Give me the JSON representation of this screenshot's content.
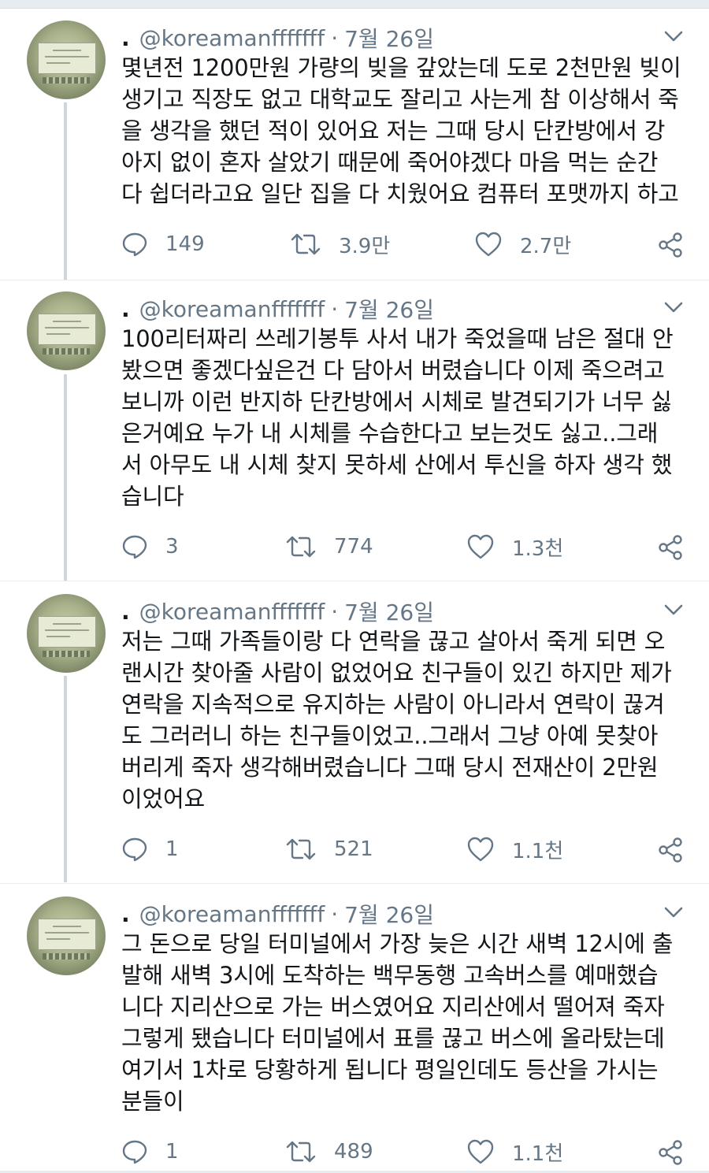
{
  "tweets": [
    {
      "handle": "@koreamanfffffff",
      "date": "7월 26일",
      "text": "몇년전 1200만원 가량의 빚을 갚았는데 도로 2천만원 빚이\n생기고 직장도 없고 대학교도 잘리고 사는게 참 이상해서 죽\n을 생각을 했던 적이 있어요 저는 그때 당시 단칸방에서 강\n아지 없이 혼자 살았기 때문에 죽어야겠다 마음 먹는 순간\n다 쉽더라고요 일단 집을 다 치웠어요 컴퓨터 포맷까지 하고",
      "replies": "149",
      "retweets": "3.9만",
      "likes": "2.7만"
    },
    {
      "handle": "@koreamanfffffff",
      "date": "7월 26일",
      "text": "100리터짜리 쓰레기봉투 사서 내가 죽었을때 남은 절대 안\n봤으면 좋겠다싶은건 다 담아서 버렸습니다 이제 죽으려고\n보니까 이런 반지하 단칸방에서 시체로 발견되기가 너무 싫\n은거예요 누가 내 시체를 수습한다고 보는것도 싫고..그래\n서 아무도 내 시체 찾지 못하세 산에서 투신을 하자 생각 했\n습니다",
      "replies": "3",
      "retweets": "774",
      "likes": "1.3천"
    },
    {
      "handle": "@koreamanfffffff",
      "date": "7월 26일",
      "text": "저는 그때 가족들이랑 다 연락을 끊고 살아서 죽게 되면 오\n랜시간 찾아줄 사람이 없었어요 친구들이 있긴 하지만 제가\n연락을 지속적으로 유지하는 사람이 아니라서 연락이 끊겨\n도 그러러니 하는 친구들이었고..그래서 그냥 아예 못찾아\n버리게 죽자 생각해버렸습니다 그때 당시 전재산이 2만원\n이었어요",
      "replies": "1",
      "retweets": "521",
      "likes": "1.1천"
    },
    {
      "handle": "@koreamanfffffff",
      "date": "7월 26일",
      "text": "그 돈으로 당일 터미널에서 가장 늦은 시간 새벽 12시에 출\n발해 새벽 3시에 도착하는 백무동행 고속버스를 예매했습\n니다 지리산으로 가는 버스였어요 지리산에서 떨어져 죽자\n그렇게 됐습니다 터미널에서 표를 끊고 버스에 올라탔는데\n여기서 1차로 당황하게 됩니다 평일인데도 등산을 가시는\n분들이",
      "replies": "1",
      "retweets": "489",
      "likes": "1.1천"
    }
  ],
  "colors": {
    "text": "#14171a",
    "muted": "#657786",
    "thread_line": "#ccd6dd",
    "divider": "#e6ecf0"
  },
  "icons": {
    "reply": "reply-icon",
    "retweet": "retweet-icon",
    "like": "heart-icon",
    "share": "share-icon",
    "menu": "chevron-down-icon"
  }
}
